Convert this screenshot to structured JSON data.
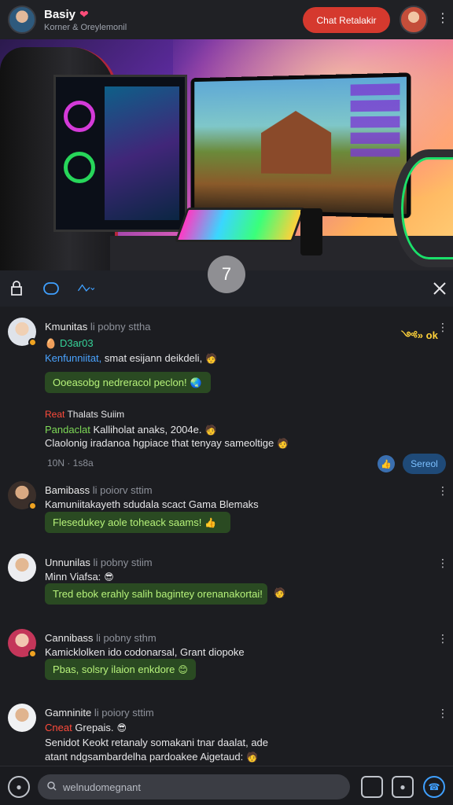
{
  "header": {
    "title": "Basiy",
    "subtitle": "Korner & Oreylemonil",
    "chat_button": "Chat Retalakir"
  },
  "hero": {
    "badge": "7"
  },
  "toolbar": {
    "icons": [
      "bookmark-icon",
      "message-icon",
      "share-icon",
      "close-icon"
    ]
  },
  "posts": [
    {
      "name": "Kmunitas",
      "meta": "li pobny sttha",
      "reaction": "༺» ok",
      "sub": "D3ar03",
      "line1_prefix": "Kenfunniitat,",
      "line1_text": " smat esijann deikdeli,",
      "bubble": "Ooeasobg nedreracol peclon!",
      "line2_prefix": "Reat",
      "line2_text": " Thalats Suiim",
      "line3_prefix": "Pandaclat",
      "line3_text": " Kalliholat anaks, 2004e.",
      "line4": "Claolonig iradanoa hgpiace that tenyay sameoltige",
      "time": "10N · 1s8a",
      "pill": "Sereol"
    },
    {
      "name": "Bamibass",
      "meta": "li poiorv sttim",
      "line1": "Kamuniitakayeth sdudala scact Gama Blemaks",
      "bubble": "Flesedukey aole toheack saams!"
    },
    {
      "name": "Unnunilas",
      "meta": "li pobny stiim",
      "line1": "Minn Viafsa:",
      "bubble": "Tred ebok erahly salih bagintey orenanakortai!"
    },
    {
      "name": "Cannibass",
      "meta": "li pobny sthm",
      "line1": "Kamicklolken ido codonarsal, Grant diopoke",
      "bubble": "Pbas, solsry ilaion enkdore"
    },
    {
      "name": "Gamninite",
      "meta": "li poiory sttim",
      "line1_prefix": "Cneat",
      "line1_text": " Grepais.",
      "line2": "Senidot Keokt retanaly somakani tnar daalat, ade",
      "line3": "atant ndgsambardelha pardoakee Aigetaud:"
    }
  ],
  "bottom": {
    "search_placeholder": "welnudomegnant"
  },
  "colors": {
    "accent": "#d5392e",
    "bubble_bg": "#2a4a22",
    "bubble_text": "#b6f27a",
    "link": "#4aa3ff"
  }
}
